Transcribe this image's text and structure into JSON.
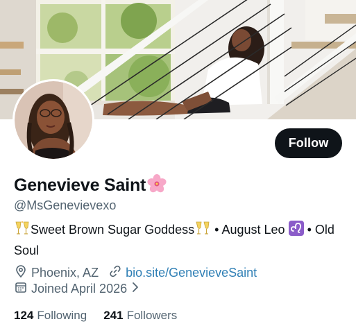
{
  "profile": {
    "display_name": "Genevieve Saint",
    "name_emoji": "cherry-blossom-emoji",
    "handle": "@MsGenevievexo",
    "follow_label": "Follow"
  },
  "bio": {
    "part1": "Sweet Brown Sugar Goddess",
    "part2": "• August Leo",
    "part3": "• Old Soul",
    "emojis": [
      "clinking-glasses-emoji",
      "leo-zodiac-emoji"
    ]
  },
  "meta": {
    "location": "Phoenix, AZ",
    "website": "bio.site/GenevieveSaint",
    "joined": "Joined April 2026"
  },
  "stats": {
    "following_count": "124",
    "following_label": "Following",
    "followers_count": "241",
    "followers_label": "Followers"
  },
  "colors": {
    "primary_text": "#0f1419",
    "secondary_text": "#536471",
    "link": "#2f7fb5",
    "follow_bg": "#0f1419",
    "leo_badge": "#8b5cc9"
  },
  "icons": {
    "location": "location-pin-icon",
    "link": "link-icon",
    "calendar": "calendar-icon",
    "chevron": "chevron-right-icon"
  }
}
